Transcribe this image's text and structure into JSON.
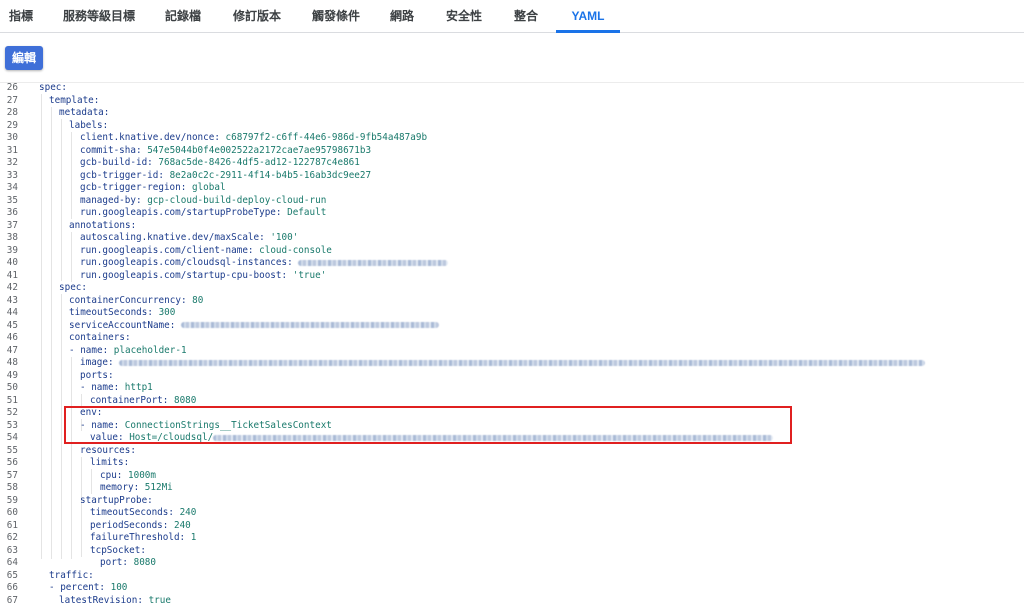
{
  "tabs": [
    {
      "label": "指標"
    },
    {
      "label": "服務等級目標"
    },
    {
      "label": "記錄檔"
    },
    {
      "label": "修訂版本"
    },
    {
      "label": "觸發條件"
    },
    {
      "label": "網路"
    },
    {
      "label": "安全性"
    },
    {
      "label": "整合"
    },
    {
      "label": "YAML"
    }
  ],
  "active_tab": "YAML",
  "toolbar": {
    "edit_label": "編輯"
  },
  "colors": {
    "accent": "#1a73e8",
    "button": "#3f6fd8",
    "highlight_box": "#e02020",
    "yaml_key": "#1c3c8c",
    "yaml_value": "#1a7a6c"
  },
  "yaml": {
    "lines": [
      {
        "n": "26",
        "key": "spec:",
        "val": ""
      },
      {
        "n": "27",
        "key": "template:",
        "val": ""
      },
      {
        "n": "28",
        "key": "metadata:",
        "val": ""
      },
      {
        "n": "29",
        "key": "labels:",
        "val": ""
      },
      {
        "n": "30",
        "key": "client.knative.dev/nonce:",
        "val": "c68797f2-c6ff-44e6-986d-9fb54a487a9b"
      },
      {
        "n": "31",
        "key": "commit-sha:",
        "val": "547e5044b0f4e002522a2172cae7ae95798671b3"
      },
      {
        "n": "32",
        "key": "gcb-build-id:",
        "val": "768ac5de-8426-4df5-ad12-122787c4e861"
      },
      {
        "n": "33",
        "key": "gcb-trigger-id:",
        "val": "8e2a0c2c-2911-4f14-b4b5-16ab3dc9ee27"
      },
      {
        "n": "34",
        "key": "gcb-trigger-region:",
        "val": "global"
      },
      {
        "n": "35",
        "key": "managed-by:",
        "val": "gcp-cloud-build-deploy-cloud-run"
      },
      {
        "n": "36",
        "key": "run.googleapis.com/startupProbeType:",
        "val": "Default"
      },
      {
        "n": "37",
        "key": "annotations:",
        "val": ""
      },
      {
        "n": "38",
        "key": "autoscaling.knative.dev/maxScale:",
        "val": "'100'"
      },
      {
        "n": "39",
        "key": "run.googleapis.com/client-name:",
        "val": "cloud-console"
      },
      {
        "n": "40",
        "key": "run.googleapis.com/cloudsql-instances:",
        "val": ""
      },
      {
        "n": "41",
        "key": "run.googleapis.com/startup-cpu-boost:",
        "val": "'true'"
      },
      {
        "n": "42",
        "key": "spec:",
        "val": ""
      },
      {
        "n": "43",
        "key": "containerConcurrency:",
        "val": "80"
      },
      {
        "n": "44",
        "key": "timeoutSeconds:",
        "val": "300"
      },
      {
        "n": "45",
        "key": "serviceAccountName:",
        "val": ""
      },
      {
        "n": "46",
        "key": "containers:",
        "val": ""
      },
      {
        "n": "47",
        "key": "- name:",
        "val": "placeholder-1"
      },
      {
        "n": "48",
        "key": "image:",
        "val": ""
      },
      {
        "n": "49",
        "key": "ports:",
        "val": ""
      },
      {
        "n": "50",
        "key": "- name:",
        "val": "http1"
      },
      {
        "n": "51",
        "key": "containerPort:",
        "val": "8080"
      },
      {
        "n": "52",
        "key": "env:",
        "val": ""
      },
      {
        "n": "53",
        "key": "- name:",
        "val": "ConnectionStrings__TicketSalesContext"
      },
      {
        "n": "54",
        "key": "value:",
        "val": "Host=/cloudsql/"
      },
      {
        "n": "55",
        "key": "resources:",
        "val": ""
      },
      {
        "n": "56",
        "key": "limits:",
        "val": ""
      },
      {
        "n": "57",
        "key": "cpu:",
        "val": "1000m"
      },
      {
        "n": "58",
        "key": "memory:",
        "val": "512Mi"
      },
      {
        "n": "59",
        "key": "startupProbe:",
        "val": ""
      },
      {
        "n": "60",
        "key": "timeoutSeconds:",
        "val": "240"
      },
      {
        "n": "61",
        "key": "periodSeconds:",
        "val": "240"
      },
      {
        "n": "62",
        "key": "failureThreshold:",
        "val": "1"
      },
      {
        "n": "63",
        "key": "tcpSocket:",
        "val": ""
      },
      {
        "n": "64",
        "key": "port:",
        "val": "8080"
      },
      {
        "n": "65",
        "key": "traffic:",
        "val": ""
      },
      {
        "n": "66",
        "key": "- percent:",
        "val": "100"
      },
      {
        "n": "67",
        "key": "latestRevision:",
        "val": "true"
      }
    ]
  }
}
